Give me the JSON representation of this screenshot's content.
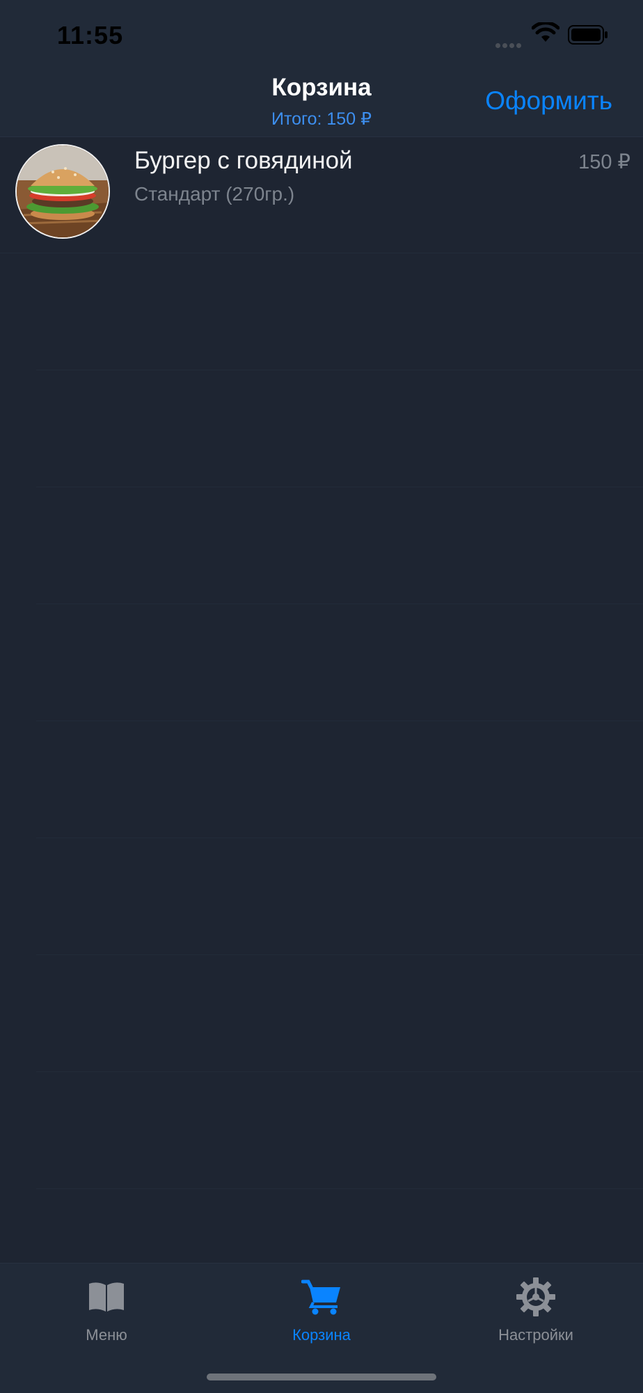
{
  "status": {
    "time": "11:55"
  },
  "nav": {
    "title": "Корзина",
    "subtitle": "Итого: 150 ₽",
    "action_label": "Оформить"
  },
  "cart": {
    "items": [
      {
        "name": "Бургер с говядиной",
        "variant": "Стандарт (270гр.)",
        "price": "150 ₽",
        "image": "burger-photo"
      }
    ]
  },
  "tabs": [
    {
      "label": "Меню",
      "icon": "book-icon",
      "active": false
    },
    {
      "label": "Корзина",
      "icon": "cart-icon",
      "active": true
    },
    {
      "label": "Настройки",
      "icon": "gear-icon",
      "active": false
    }
  ],
  "colors": {
    "accent": "#0a84ff",
    "background": "#1e2532",
    "bar": "#212a38",
    "secondary_text": "#7d848e",
    "inactive_tab": "#8c9097"
  }
}
